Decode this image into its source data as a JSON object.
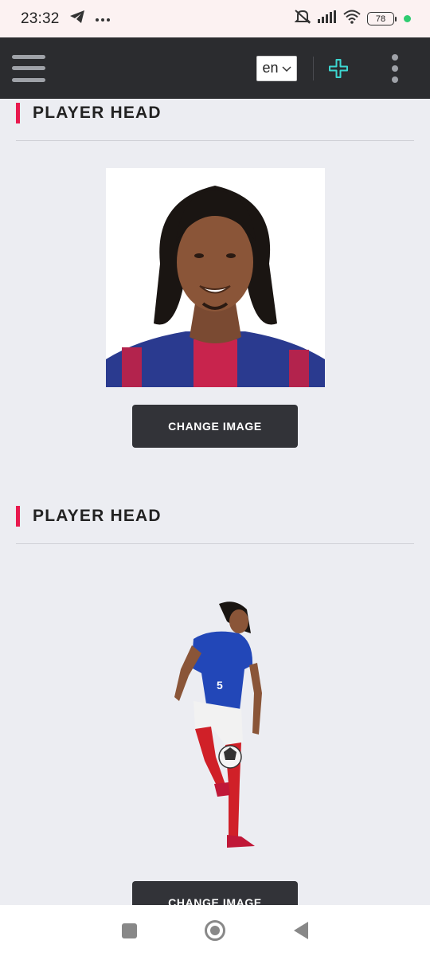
{
  "status_bar": {
    "time": "23:32",
    "battery": "78",
    "icons": [
      "telegram-icon",
      "more-dots-icon",
      "mute-icon",
      "signal-icon",
      "wifi-icon",
      "battery-icon"
    ]
  },
  "header": {
    "language": "en",
    "icons": [
      "menu-icon",
      "chevron-down-icon",
      "plus-icon",
      "kebab-icon"
    ],
    "accent_color": "#3dd6d0"
  },
  "sections": [
    {
      "title": "PLAYER HEAD",
      "button_label": "CHANGE IMAGE"
    },
    {
      "title": "PLAYER HEAD",
      "button_label": "CHANGE IMAGE"
    }
  ],
  "colors": {
    "title_bar": "#e8194e",
    "button": "#323338",
    "header": "#2b2c2f"
  }
}
